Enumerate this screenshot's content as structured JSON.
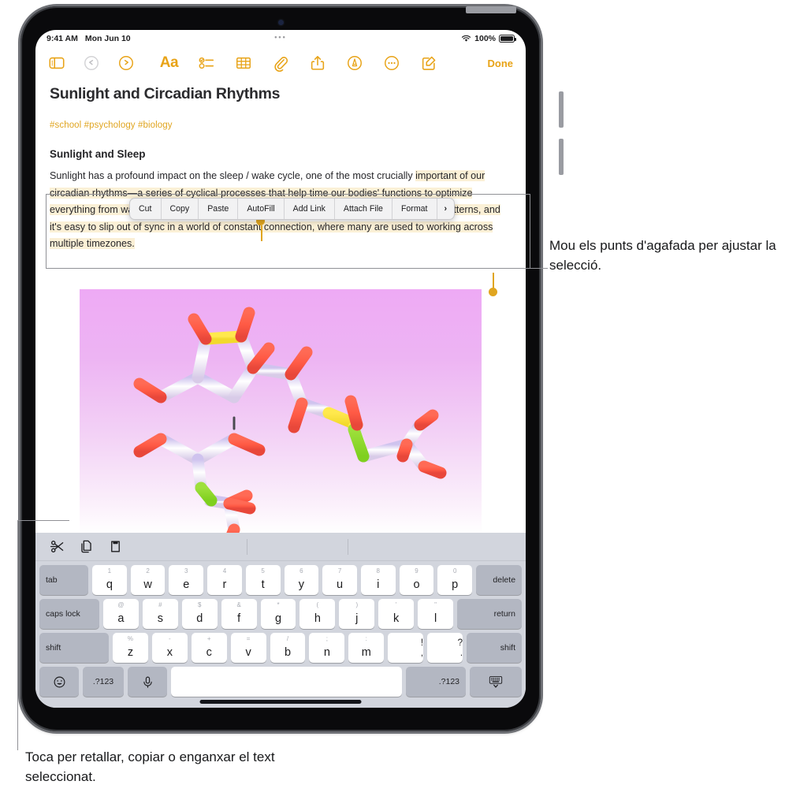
{
  "device": {
    "name": "ipad"
  },
  "statusbar": {
    "time": "9:41 AM",
    "date": "Mon Jun 10",
    "dots": "•••",
    "battery_percent": "100%",
    "wifi_icon": "wifi-icon",
    "battery_icon": "battery-icon"
  },
  "toolbar": {
    "sidebar_icon": "sidebar-toggle-icon",
    "undo_icon": "undo-icon",
    "redo_icon": "redo-icon",
    "format_label": "Aa",
    "checklist_icon": "checklist-icon",
    "table_icon": "table-icon",
    "attach_icon": "paperclip-icon",
    "share_icon": "share-icon",
    "markup_icon": "markup-icon",
    "more_icon": "more-ellipsis-icon",
    "compose_icon": "compose-icon",
    "done_label": "Done"
  },
  "note": {
    "title": "Sunlight and Circadian Rhythms",
    "tags": "#school #psychology #biology",
    "subheading": "Sunlight and Sleep",
    "paragraph_prefix": "Sunlight has a profound impact on the sleep / wake cycle, one of the most crucially ",
    "paragraph_selected": "important of our circadian rhythms—a series of cyclical processes that help time our bodies' functions to optimize everything from wakefulness to digestion. Consistency is key to developing healthy sleep patterns, and it's easy to slip out of sync in a world of constant connection, where many are used to working across multiple timezones.",
    "image_name": "molecule-image",
    "selection_handle_start": "selection-handle-start",
    "selection_handle_end": "selection-handle-end"
  },
  "context_menu": {
    "items": [
      {
        "label": "Cut"
      },
      {
        "label": "Copy"
      },
      {
        "label": "Paste"
      },
      {
        "label": "AutoFill"
      },
      {
        "label": "Add Link"
      },
      {
        "label": "Attach File"
      },
      {
        "label": "Format"
      },
      {
        "label": "›"
      }
    ]
  },
  "shortcut_bar": {
    "cut_icon": "scissors-icon",
    "copy_icon": "copy-icon",
    "paste_icon": "paste-icon"
  },
  "keyboard": {
    "row1": {
      "tab": "tab",
      "keys": [
        {
          "sup": "1",
          "main": "q"
        },
        {
          "sup": "2",
          "main": "w"
        },
        {
          "sup": "3",
          "main": "e"
        },
        {
          "sup": "4",
          "main": "r"
        },
        {
          "sup": "5",
          "main": "t"
        },
        {
          "sup": "6",
          "main": "y"
        },
        {
          "sup": "7",
          "main": "u"
        },
        {
          "sup": "8",
          "main": "i"
        },
        {
          "sup": "9",
          "main": "o"
        },
        {
          "sup": "0",
          "main": "p"
        }
      ],
      "delete": "delete"
    },
    "row2": {
      "caps": "caps lock",
      "keys": [
        {
          "sup": "@",
          "main": "a"
        },
        {
          "sup": "#",
          "main": "s"
        },
        {
          "sup": "$",
          "main": "d"
        },
        {
          "sup": "&",
          "main": "f"
        },
        {
          "sup": "*",
          "main": "g"
        },
        {
          "sup": "(",
          "main": "h"
        },
        {
          "sup": ")",
          "main": "j"
        },
        {
          "sup": "'",
          "main": "k"
        },
        {
          "sup": "\"",
          "main": "l"
        }
      ],
      "return": "return"
    },
    "row3": {
      "shift_left": "shift",
      "keys": [
        {
          "sup": "%",
          "main": "z"
        },
        {
          "sup": "-",
          "main": "x"
        },
        {
          "sup": "+",
          "main": "c"
        },
        {
          "sup": "=",
          "main": "v"
        },
        {
          "sup": "/",
          "main": "b"
        },
        {
          "sup": ";",
          "main": "n"
        },
        {
          "sup": ":",
          "main": "m"
        }
      ],
      "dual": [
        {
          "top": "!",
          "bot": ","
        },
        {
          "top": "?",
          "bot": "."
        }
      ],
      "shift_right": "shift"
    },
    "row4": {
      "emoji_icon": "emoji-icon",
      "numbers_left": ".?123",
      "mic_icon": "microphone-icon",
      "space": "",
      "numbers_right": ".?123",
      "hide_keyboard_icon": "hide-keyboard-icon"
    }
  },
  "callouts": {
    "right": "Mou els punts d'agafada per ajustar la selecció.",
    "bottom": "Toca per retallar, copiar o enganxar el text seleccionat."
  },
  "colors": {
    "accent": "#e8a317",
    "selection_highlight": "#fbf0d6",
    "keyboard_bg": "#d2d5dd",
    "modifier_key": "#b3b7c2"
  }
}
